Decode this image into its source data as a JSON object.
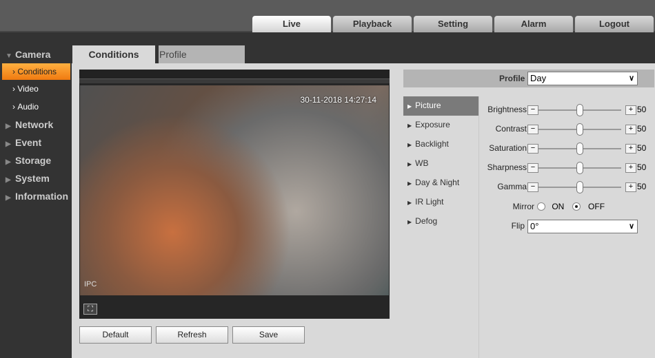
{
  "topnav": {
    "tabs": [
      {
        "label": "Live",
        "active": true
      },
      {
        "label": "Playback"
      },
      {
        "label": "Setting"
      },
      {
        "label": "Alarm"
      },
      {
        "label": "Logout"
      }
    ]
  },
  "sidebar": {
    "camera": "Camera",
    "items": [
      "Conditions",
      "Video",
      "Audio"
    ],
    "groups": [
      "Network",
      "Event",
      "Storage",
      "System",
      "Information"
    ]
  },
  "tabs": {
    "conditions": "Conditions",
    "profile_management": "Profile Management"
  },
  "video": {
    "timestamp": "30-11-2018 14:27:14",
    "watermark": "IPC",
    "fullscreen_icon": "fullscreen-icon"
  },
  "buttons": {
    "default": "Default",
    "refresh": "Refresh",
    "save": "Save"
  },
  "profile": {
    "label": "Profile",
    "value": "Day"
  },
  "submenu": [
    "Picture",
    "Exposure",
    "Backlight",
    "WB",
    "Day & Night",
    "IR Light",
    "Defog"
  ],
  "picture": {
    "sliders": [
      {
        "label": "Brightness",
        "value": "50"
      },
      {
        "label": "Contrast",
        "value": "50"
      },
      {
        "label": "Saturation",
        "value": "50"
      },
      {
        "label": "Sharpness",
        "value": "50"
      },
      {
        "label": "Gamma",
        "value": "50"
      }
    ],
    "mirror": {
      "label": "Mirror",
      "on": "ON",
      "off": "OFF",
      "selected": "OFF"
    },
    "flip": {
      "label": "Flip",
      "value": "0°"
    }
  },
  "colors": {
    "accent": "#f59020",
    "topbar": "#5b5b5b",
    "sidebar": "#333333",
    "content": "#d9d9d9"
  }
}
